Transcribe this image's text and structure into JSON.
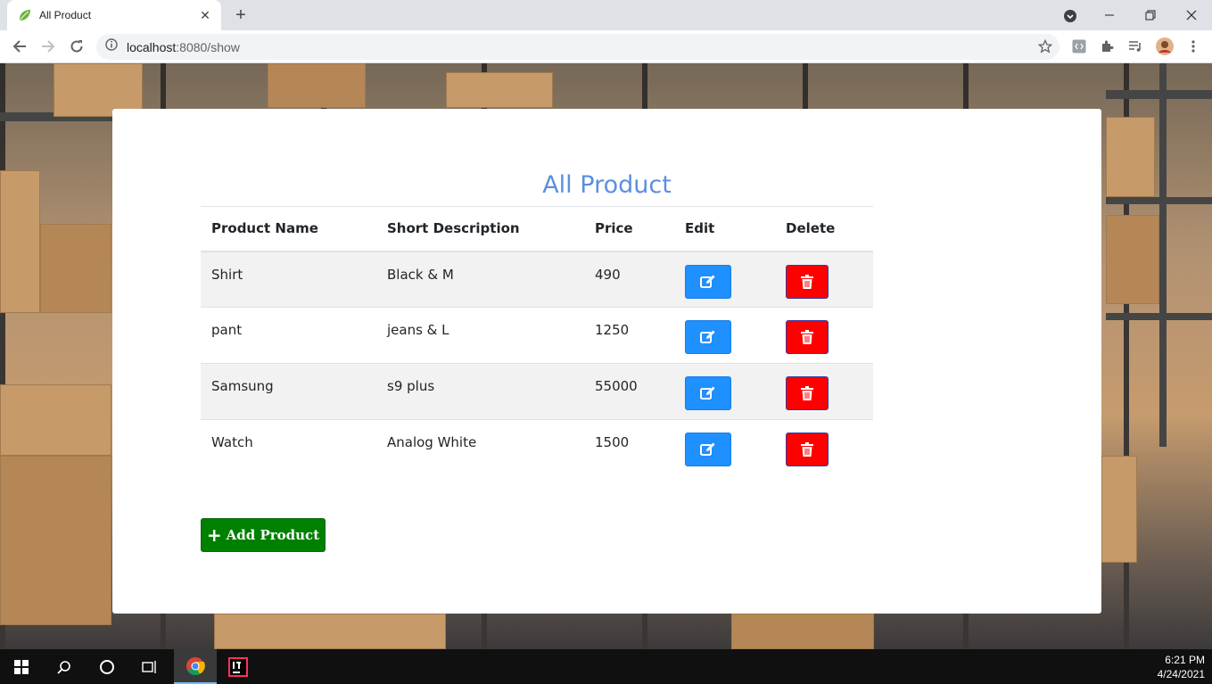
{
  "browser": {
    "tab_title": "All Product",
    "tab_close": "✕",
    "new_tab": "+",
    "url_host": "localhost",
    "url_rest": ":8080/show"
  },
  "page": {
    "heading": "All Product",
    "columns": [
      "Product Name",
      "Short Description",
      "Price",
      "Edit",
      "Delete"
    ],
    "rows": [
      {
        "name": "Shirt",
        "desc": "Black & M",
        "price": "490"
      },
      {
        "name": "pant",
        "desc": "jeans & L",
        "price": "1250"
      },
      {
        "name": "Samsung",
        "desc": "s9 plus",
        "price": "55000"
      },
      {
        "name": "Watch",
        "desc": "Analog White",
        "price": "1500"
      }
    ],
    "add_label": "Add Product",
    "add_icon": "+"
  },
  "taskbar": {
    "time": "6:21 PM",
    "date": "4/24/2021"
  },
  "colors": {
    "heading": "#5b8fdf",
    "edit": "#1e90ff",
    "delete": "#ff0000",
    "add": "#008000"
  }
}
